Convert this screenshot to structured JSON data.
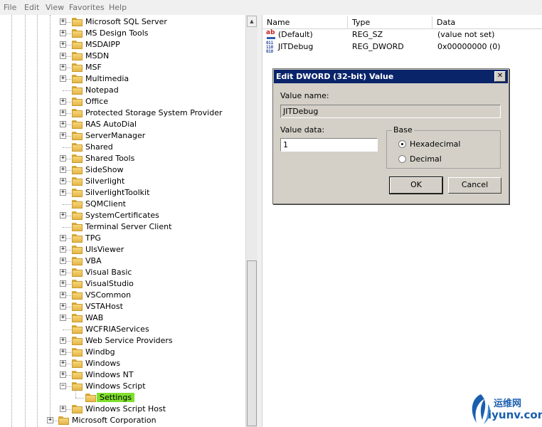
{
  "menu": [
    "File",
    "Edit",
    "View",
    "Favorites",
    "Help"
  ],
  "tree": {
    "nodes": [
      {
        "label": "Microsoft SQL Server",
        "expander": "+"
      },
      {
        "label": "MS Design Tools",
        "expander": "+"
      },
      {
        "label": "MSDAIPP",
        "expander": "+"
      },
      {
        "label": "MSDN",
        "expander": "+"
      },
      {
        "label": "MSF",
        "expander": "+"
      },
      {
        "label": "Multimedia",
        "expander": "+"
      },
      {
        "label": "Notepad",
        "expander": ""
      },
      {
        "label": "Office",
        "expander": "+"
      },
      {
        "label": "Protected Storage System Provider",
        "expander": "+"
      },
      {
        "label": "RAS AutoDial",
        "expander": "+"
      },
      {
        "label": "ServerManager",
        "expander": "+"
      },
      {
        "label": "Shared",
        "expander": ""
      },
      {
        "label": "Shared Tools",
        "expander": "+"
      },
      {
        "label": "SideShow",
        "expander": "+"
      },
      {
        "label": "Silverlight",
        "expander": "+"
      },
      {
        "label": "SilverlightToolkit",
        "expander": "+"
      },
      {
        "label": "SQMClient",
        "expander": ""
      },
      {
        "label": "SystemCertificates",
        "expander": "+"
      },
      {
        "label": "Terminal Server Client",
        "expander": ""
      },
      {
        "label": "TPG",
        "expander": "+"
      },
      {
        "label": "UlsViewer",
        "expander": "+"
      },
      {
        "label": "VBA",
        "expander": "+"
      },
      {
        "label": "Visual Basic",
        "expander": "+"
      },
      {
        "label": "VisualStudio",
        "expander": "+"
      },
      {
        "label": "VSCommon",
        "expander": "+"
      },
      {
        "label": "VSTAHost",
        "expander": "+"
      },
      {
        "label": "WAB",
        "expander": "+"
      },
      {
        "label": "WCFRIAServices",
        "expander": ""
      },
      {
        "label": "Web Service Providers",
        "expander": "+"
      },
      {
        "label": "Windbg",
        "expander": "+"
      },
      {
        "label": "Windows",
        "expander": "+"
      },
      {
        "label": "Windows NT",
        "expander": "+"
      },
      {
        "label": "Windows Script",
        "expander": "−"
      },
      {
        "label": "Settings",
        "expander": "",
        "selected": true,
        "child": true
      },
      {
        "label": "Windows Script Host",
        "expander": "+"
      },
      {
        "label": "Microsoft Corporation",
        "expander": "+",
        "parent": true
      }
    ]
  },
  "list": {
    "columns": [
      "Name",
      "Type",
      "Data"
    ],
    "rows": [
      {
        "icon": "string-value-icon",
        "name": "(Default)",
        "type": "REG_SZ",
        "data": "(value not set)"
      },
      {
        "icon": "binary-value-icon",
        "name": "JITDebug",
        "type": "REG_DWORD",
        "data": "0x00000000 (0)"
      }
    ]
  },
  "dialog": {
    "title": "Edit DWORD (32-bit) Value",
    "close": "✕",
    "value_name_label": "Value name:",
    "value_name": "JITDebug",
    "value_data_label": "Value data:",
    "value_data": "1",
    "base_label": "Base",
    "hex_label": "Hexadecimal",
    "dec_label": "Decimal",
    "ok_label": "OK",
    "cancel_label": "Cancel"
  },
  "watermark": {
    "line1": "运维网",
    "line2": "iyunv.com"
  },
  "colors": {
    "selection": "#7fe02d",
    "dialog_title": "#0a246a",
    "watermark": "#1a5fae"
  }
}
